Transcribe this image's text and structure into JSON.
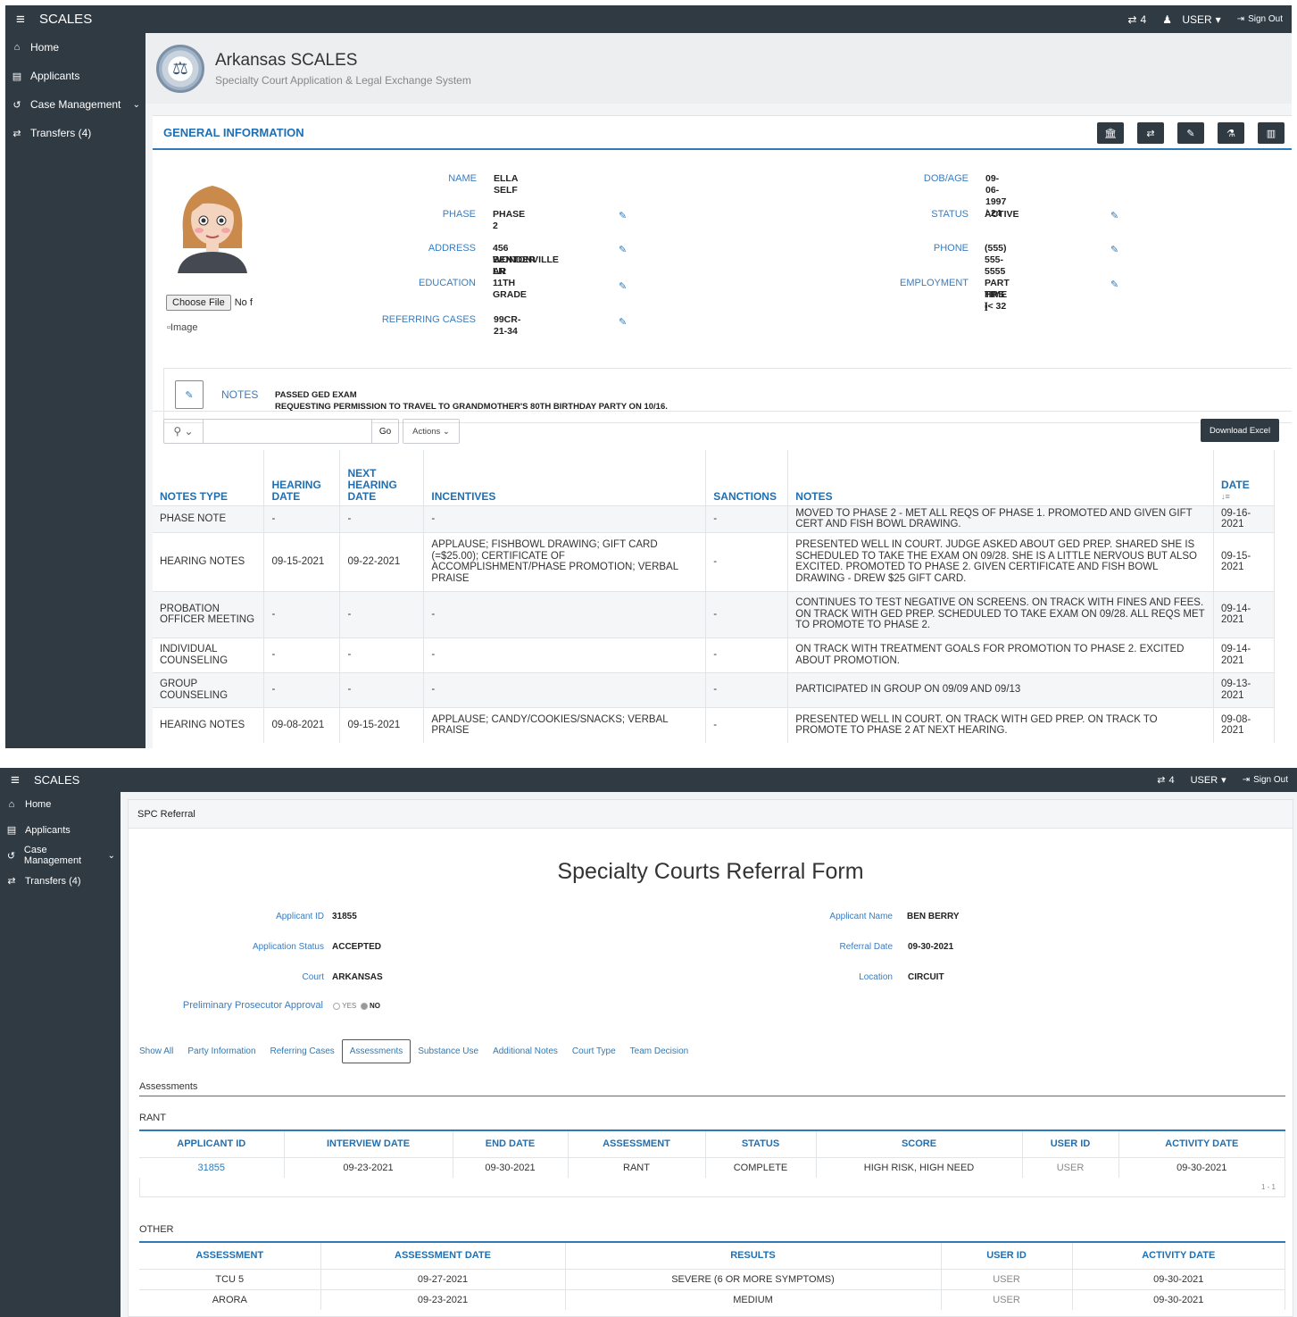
{
  "app": {
    "brand": "SCALES",
    "transfer_count": "4",
    "user_label": "USER",
    "signout_label": "Sign Out"
  },
  "sidebar": {
    "items": [
      {
        "label": "Home",
        "icon": "home-icon"
      },
      {
        "label": "Applicants",
        "icon": "list-icon"
      },
      {
        "label": "Case Management",
        "icon": "history-icon"
      },
      {
        "label": "Transfers (4)",
        "icon": "transfer-icon"
      }
    ]
  },
  "header": {
    "title": "Arkansas SCALES",
    "subtitle": "Specialty Court Application & Legal Exchange System"
  },
  "general": {
    "section_title": "GENERAL INFORMATION",
    "fields": {
      "name_label": "NAME",
      "name": "ELLA SELF",
      "phase_label": "PHASE",
      "phase": "PHASE 2",
      "address_label": "ADDRESS",
      "address_line1": "456 WONDER LN",
      "address_line2": "BENTONVILLE AR",
      "education_label": "EDUCATION",
      "education": "11TH GRADE",
      "referring_label": "REFERRING CASES",
      "referring": "99CR-21-34",
      "dob_label": "DOB/AGE",
      "dob": "09-06-1997 / 24",
      "status_label": "STATUS",
      "status": "ACTIVE",
      "phone_label": "PHONE",
      "phone": "(555) 555-5555",
      "employment_label": "EMPLOYMENT",
      "employment_line1": "PART TIME (< 32",
      "employment_line2": "HRS )"
    },
    "file_button": "Choose File",
    "file_status": "No f",
    "image_alt": "Image",
    "notes_label": "NOTES",
    "notes_line1": "PASSED GED EXAM",
    "notes_line2": "REQUESTING PERMISSION TO TRAVEL TO GRANDMOTHER'S 80TH BIRTHDAY PARTY ON 10/16."
  },
  "grid": {
    "go_label": "Go",
    "actions_label": "Actions",
    "download_label": "Download Excel",
    "columns": {
      "notes_type": "NOTES TYPE",
      "hearing_date_1": "HEARING",
      "hearing_date_2": "DATE",
      "next_1": "NEXT",
      "next_2": "HEARING",
      "next_3": "DATE",
      "incentives": "INCENTIVES",
      "sanctions": "SANCTIONS",
      "notes": "NOTES",
      "date": "DATE"
    },
    "rows": [
      {
        "type": "PHASE NOTE",
        "hearing": "-",
        "next": "-",
        "incentives": "-",
        "sanctions": "-",
        "notes": "MOVED TO PHASE 2 - MET ALL REQS OF PHASE 1. PROMOTED AND GIVEN GIFT CERT AND FISH BOWL DRAWING.",
        "date": "09-16-2021"
      },
      {
        "type": "HEARING NOTES",
        "hearing": "09-15-2021",
        "next": "09-22-2021",
        "incentives": "APPLAUSE; FISHBOWL DRAWING; GIFT CARD (=$25.00); CERTIFICATE OF ACCOMPLISHMENT/PHASE PROMOTION; VERBAL PRAISE",
        "sanctions": "-",
        "notes": "PRESENTED WELL IN COURT. JUDGE ASKED ABOUT GED PREP. SHARED SHE IS SCHEDULED TO TAKE THE EXAM ON 09/28. SHE IS A LITTLE NERVOUS BUT ALSO EXCITED. PROMOTED TO PHASE 2. GIVEN CERTIFICATE AND FISH BOWL DRAWING - DREW $25 GIFT CARD.",
        "date": "09-15-2021"
      },
      {
        "type": "PROBATION OFFICER MEETING",
        "hearing": "-",
        "next": "-",
        "incentives": "-",
        "sanctions": "-",
        "notes": "CONTINUES TO TEST NEGATIVE ON SCREENS. ON TRACK WITH FINES AND FEES. ON TRACK WITH GED PREP. SCHEDULED TO TAKE EXAM ON 09/28. ALL REQS MET TO PROMOTE TO PHASE 2.",
        "date": "09-14-2021"
      },
      {
        "type": "INDIVIDUAL COUNSELING",
        "hearing": "-",
        "next": "-",
        "incentives": "-",
        "sanctions": "-",
        "notes": "ON TRACK WITH TREATMENT GOALS FOR PROMOTION TO PHASE 2. EXCITED ABOUT PROMOTION.",
        "date": "09-14-2021"
      },
      {
        "type": "GROUP COUNSELING",
        "hearing": "-",
        "next": "-",
        "incentives": "-",
        "sanctions": "-",
        "notes": "PARTICIPATED IN GROUP ON 09/09 AND 09/13",
        "date": "09-13-2021"
      },
      {
        "type": "HEARING NOTES",
        "hearing": "09-08-2021",
        "next": "09-15-2021",
        "incentives": "APPLAUSE; CANDY/COOKIES/SNACKS; VERBAL PRAISE",
        "sanctions": "-",
        "notes": "PRESENTED WELL IN COURT. ON TRACK WITH GED PREP. ON TRACK TO PROMOTE TO PHASE 2 AT NEXT HEARING.",
        "date": "09-08-2021"
      }
    ]
  },
  "referral": {
    "breadcrumb": "SPC Referral",
    "title": "Specialty Courts Referral Form",
    "applicant_id_label": "Applicant ID",
    "applicant_id": "31855",
    "app_status_label": "Application Status",
    "app_status": "ACCEPTED",
    "court_label": "Court",
    "court": "ARKANSAS",
    "prelim_label": "Preliminary Prosecutor Approval",
    "yes": "YES",
    "no": "NO",
    "applicant_name_label": "Applicant Name",
    "applicant_name": "BEN BERRY",
    "referral_date_label": "Referral Date",
    "referral_date": "09-30-2021",
    "location_label": "Location",
    "location": "CIRCUIT",
    "tabs": [
      "Show All",
      "Party Information",
      "Referring Cases",
      "Assessments",
      "Substance Use",
      "Additional Notes",
      "Court Type",
      "Team Decision"
    ],
    "active_tab": "Assessments",
    "section": "Assessments",
    "rant": {
      "label": "RANT",
      "columns": [
        "APPLICANT ID",
        "INTERVIEW DATE",
        "END DATE",
        "ASSESSMENT",
        "STATUS",
        "SCORE",
        "USER ID",
        "ACTIVITY DATE"
      ],
      "rows": [
        [
          "31855",
          "09-23-2021",
          "09-30-2021",
          "RANT",
          "COMPLETE",
          "HIGH RISK, HIGH NEED",
          "USER",
          "09-30-2021"
        ]
      ],
      "pager": "1 - 1"
    },
    "other": {
      "label": "OTHER",
      "columns": [
        "ASSESSMENT",
        "ASSESSMENT DATE",
        "RESULTS",
        "USER ID",
        "ACTIVITY DATE"
      ],
      "rows": [
        [
          "TCU 5",
          "09-27-2021",
          "SEVERE (6 OR MORE SYMPTOMS)",
          "USER",
          "09-30-2021"
        ],
        [
          "ARORA",
          "09-23-2021",
          "MEDIUM",
          "USER",
          "09-30-2021"
        ]
      ]
    }
  }
}
